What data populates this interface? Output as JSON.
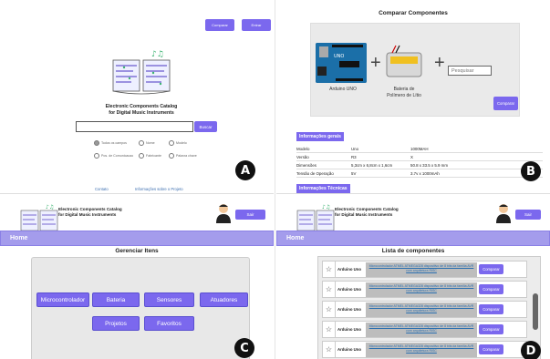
{
  "panel_a": {
    "compare_button": "Comparar",
    "enter_button": "Entrar",
    "title_line1": "Electronic Components Catalog",
    "title_line2": "for Digital Music Instruments",
    "search": {
      "value": "",
      "placeholder": ""
    },
    "search_button": "Buscar",
    "filters": [
      {
        "label": "Todos os campos",
        "selected": true
      },
      {
        "label": "Nome",
        "selected": false
      },
      {
        "label": "Modelo",
        "selected": false
      },
      {
        "label": "Pos. de Comunicacao",
        "selected": false
      },
      {
        "label": "Fabricante",
        "selected": false
      },
      {
        "label": "Palavra chave",
        "selected": false
      }
    ],
    "links": {
      "contact": "Contato",
      "about": "Informações sobre o Projeto"
    },
    "badge": "A"
  },
  "panel_b": {
    "title": "Comparar Componentes",
    "component1_caption": "Arduino UNO",
    "component2_caption_line1": "Bateria de",
    "component2_caption_line2": "Polímero de Lítio",
    "search_placeholder": "Pesquisar",
    "compare_button": "Comparar",
    "general_info_header": "Informações gerais",
    "general_info_rows": [
      {
        "label": "Modelo",
        "v1": "Uno",
        "v2": "1000MAH"
      },
      {
        "label": "Versão",
        "v1": "R3",
        "v2": "X"
      },
      {
        "label": "Dimensões",
        "v1": "5,3cm x 6,8cm x 1,6cm",
        "v2": "50.8 x 33.5 x 5.9 mm"
      },
      {
        "label": "Tensão de Operação",
        "v1": "5V",
        "v2": "3.7v x 1000mAh"
      }
    ],
    "tech_info_header": "Informações Técnicas",
    "badge": "B"
  },
  "panel_c": {
    "title_line1": "Electronic Components Catalog",
    "title_line2": "for Digital Music Instruments",
    "exit_button": "Sair",
    "home_label": "Home",
    "section_title": "Gerenciar Itens",
    "categories": [
      "Microcontrolador",
      "Bateria",
      "Sensores",
      "Atuadores",
      "Projetos",
      "Favoritos"
    ],
    "badge": "C"
  },
  "panel_d": {
    "title_line1": "Electronic Components Catalog",
    "title_line2": "for Digital Music Instruments",
    "exit_button": "Sair",
    "home_label": "Home",
    "section_title": "Lista de componentes",
    "items": [
      {
        "name": "Arduino Uno",
        "desc": "Microcontrolador ATMEL ATMEGA328 dispositivo de 8 bits da família AVR com arquitetura RISC",
        "button": "Comparar"
      },
      {
        "name": "Arduino Uno",
        "desc": "Microcontrolador ATMEL ATMEGA328 dispositivo de 8 bits da família AVR com arquitetura RISC",
        "button": "Comparar"
      },
      {
        "name": "Arduino Uno",
        "desc": "Microcontrolador ATMEL ATMEGA328 dispositivo de 8 bits da família AVR com arquitetura RISC",
        "button": "Comparar"
      },
      {
        "name": "Arduino Uno",
        "desc": "Microcontrolador ATMEL ATMEGA328 dispositivo de 8 bits da família AVR com arquitetura RISC",
        "button": "Comparar"
      },
      {
        "name": "Arduino Uno",
        "desc": "Microcontrolador ATMEL ATMEGA328 dispositivo de 8 bits da família AVR com arquitetura RISC",
        "button": "Comparar"
      }
    ],
    "badge": "D"
  },
  "colors": {
    "accent": "#7b68ee",
    "home_bar": "#a49cec",
    "link": "#3d6fb0"
  }
}
